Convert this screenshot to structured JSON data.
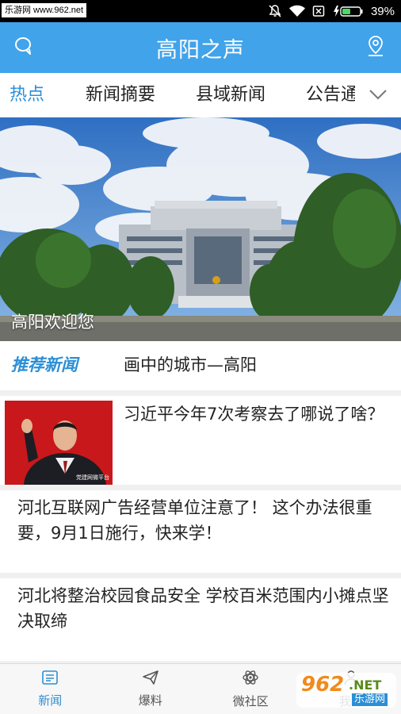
{
  "status_bar": {
    "watermark": "乐游网 www.962.net",
    "battery": "39%"
  },
  "header": {
    "title": "高阳之声",
    "left_icon": "chat-bubble-icon",
    "right_icon": "location-pin-icon"
  },
  "tabs": {
    "items": [
      {
        "label": "热点",
        "active": true
      },
      {
        "label": "新闻摘要",
        "active": false
      },
      {
        "label": "县域新闻",
        "active": false
      },
      {
        "label": "公告通",
        "active": false
      }
    ],
    "more_icon": "chevron-down-icon"
  },
  "banner": {
    "caption": "高阳欢迎您"
  },
  "recommended": {
    "tag": "推荐新闻",
    "title": "画中的城市—高阳"
  },
  "news": [
    {
      "title": "习近平今年7次考察去了哪说了啥？",
      "has_image": true,
      "image_watermark": "党建网微平台"
    },
    {
      "title": "河北互联网广告经营单位注意了！ 这个办法很重要，9月1日施行，快来学！",
      "has_image": false
    },
    {
      "title": "河北将整治校园食品安全 学校百米范围内小摊点坚决取缔",
      "has_image": false
    }
  ],
  "bottom_nav": [
    {
      "label": "新闻",
      "icon": "newspaper-icon",
      "active": true
    },
    {
      "label": "爆料",
      "icon": "paper-plane-icon",
      "active": false
    },
    {
      "label": "微社区",
      "icon": "atom-icon",
      "active": false
    },
    {
      "label": "我的",
      "icon": "user-icon",
      "active": false
    }
  ],
  "site_badge": {
    "number": "962",
    "suffix": ".NET",
    "text": "乐游网"
  },
  "colors": {
    "accent": "#41a3ea",
    "tab_active": "#2c8fd6"
  }
}
